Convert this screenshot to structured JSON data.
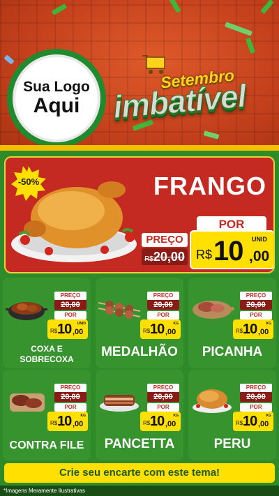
{
  "logo": {
    "line1": "Sua Logo",
    "line2": "Aqui"
  },
  "title": {
    "top": "Setembro",
    "main": "imbatível"
  },
  "hero": {
    "discount_badge": "-50%",
    "product_name": "FRANGO",
    "old_label": "PREÇO",
    "old_currency": "R$",
    "old_price": "20,00",
    "new_label": "POR",
    "new_currency": "R$",
    "new_int": "10",
    "new_dec": ",00",
    "unit": "UNID"
  },
  "cards": [
    {
      "name": "COXA E SOBRECOXA",
      "preco_label": "PREÇO",
      "old_price": "20,00",
      "por_label": "POR",
      "currency": "R$",
      "int": "10",
      "dec": ",00",
      "unit": "UNID",
      "icon": "chicken-pot-icon"
    },
    {
      "name": "MEDALHÃO",
      "preco_label": "PREÇO",
      "old_price": "20,00",
      "por_label": "POR",
      "currency": "R$",
      "int": "10",
      "dec": ",00",
      "unit": "KG",
      "icon": "skewers-icon"
    },
    {
      "name": "PICANHA",
      "preco_label": "PREÇO",
      "old_price": "20,00",
      "por_label": "POR",
      "currency": "R$",
      "int": "10",
      "dec": ",00",
      "unit": "KG",
      "icon": "steak-board-icon"
    },
    {
      "name": "CONTRA FILE",
      "preco_label": "PREÇO",
      "old_price": "20,00",
      "por_label": "POR",
      "currency": "R$",
      "int": "10",
      "dec": ",00",
      "unit": "KG",
      "icon": "steak-icon"
    },
    {
      "name": "PANCETTA",
      "preco_label": "PREÇO",
      "old_price": "20,00",
      "por_label": "POR",
      "currency": "R$",
      "int": "10",
      "dec": ",00",
      "unit": "KG",
      "icon": "pork-belly-icon"
    },
    {
      "name": "PERU",
      "preco_label": "PREÇO",
      "old_price": "20,00",
      "por_label": "POR",
      "currency": "R$",
      "int": "10",
      "dec": ",00",
      "unit": "KG",
      "icon": "turkey-icon"
    }
  ],
  "cta": "Crie seu encarte com este tema!",
  "disclaimer": "*Imagens Meramente Ilustrativas",
  "colors": {
    "header_red": "#c8441f",
    "panel_red": "#c42a21",
    "green": "#37932e",
    "yellow": "#ffe000"
  }
}
